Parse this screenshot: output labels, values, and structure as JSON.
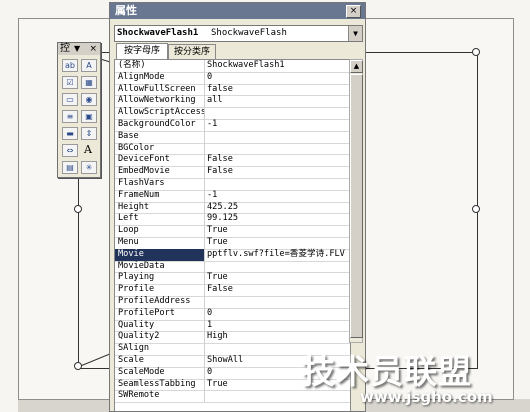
{
  "toolbox": {
    "title": "控",
    "dropdown": "▼",
    "close": "×",
    "tools": [
      "textbox-tool-icon",
      "label-tool-icon",
      "checkbox-tool-icon",
      "image-tool-icon",
      "combobox-tool-icon",
      "option-button-tool-icon",
      "listbox-tool-icon",
      "frame-tool-icon",
      "toggle-button-tool-icon",
      "spin-button-tool-icon",
      "scrollbar-tool-icon",
      "text-label-tool-icon",
      "image-control-tool-icon",
      "more-controls-tool-icon"
    ],
    "letter_a": "A"
  },
  "properties": {
    "title": "属性",
    "close": "×",
    "object_name": "ShockwaveFlash1",
    "object_type": "ShockwaveFlash",
    "dropdown_arrow": "▼",
    "tabs": [
      "按字母序",
      "按分类序"
    ],
    "rows": [
      {
        "name": "(名称)",
        "value": "ShockwaveFlash1"
      },
      {
        "name": "AlignMode",
        "value": "0"
      },
      {
        "name": "AllowFullScreen",
        "value": "false"
      },
      {
        "name": "AllowNetworking",
        "value": "all"
      },
      {
        "name": "AllowScriptAccess",
        "value": ""
      },
      {
        "name": "BackgroundColor",
        "value": "-1"
      },
      {
        "name": "Base",
        "value": ""
      },
      {
        "name": "BGColor",
        "value": ""
      },
      {
        "name": "DeviceFont",
        "value": "False"
      },
      {
        "name": "EmbedMovie",
        "value": "False"
      },
      {
        "name": "FlashVars",
        "value": ""
      },
      {
        "name": "FrameNum",
        "value": "-1"
      },
      {
        "name": "Height",
        "value": "425.25"
      },
      {
        "name": "Left",
        "value": "99.125"
      },
      {
        "name": "Loop",
        "value": "True"
      },
      {
        "name": "Menu",
        "value": "True"
      },
      {
        "name": "Movie",
        "value": "pptflv.swf?file=香菱学诗.FLV",
        "selected": true
      },
      {
        "name": "MovieData",
        "value": ""
      },
      {
        "name": "Playing",
        "value": "True"
      },
      {
        "name": "Profile",
        "value": "False"
      },
      {
        "name": "ProfileAddress",
        "value": ""
      },
      {
        "name": "ProfilePort",
        "value": "0"
      },
      {
        "name": "Quality",
        "value": "1"
      },
      {
        "name": "Quality2",
        "value": "High"
      },
      {
        "name": "SAlign",
        "value": ""
      },
      {
        "name": "Scale",
        "value": "ShowAll"
      },
      {
        "name": "ScaleMode",
        "value": "0"
      },
      {
        "name": "SeamlessTabbing",
        "value": "True"
      },
      {
        "name": "SWRemote",
        "value": ""
      }
    ],
    "scroll_up": "▲",
    "scroll_down": "▼"
  },
  "watermark": {
    "main": "技术员联盟",
    "url": "www.jsgho.com"
  },
  "colors": {
    "titlebar": "#6a7790",
    "selected_row": "#22335b"
  }
}
